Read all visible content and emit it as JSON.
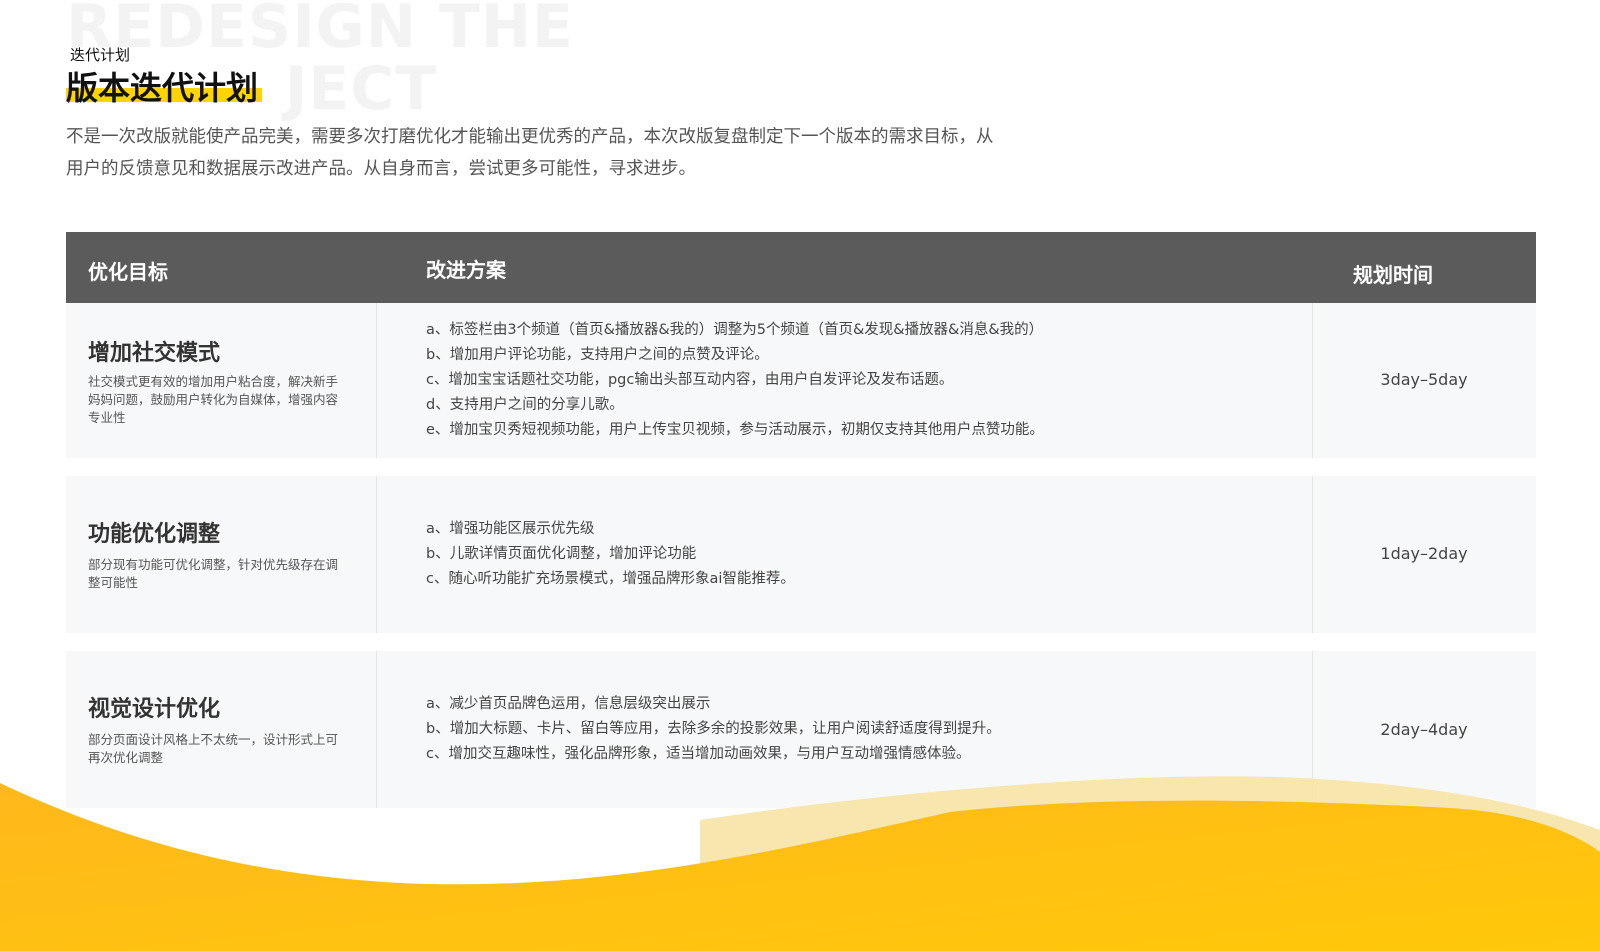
{
  "header": {
    "watermark": "REDESIGN THE\n          JECT",
    "eyebrow": "迭代计划",
    "title": "版本迭代计划",
    "intro": "不是一次改版就能使产品完美，需要多次打磨优化才能输出更优秀的产品，本次改版复盘制定下一个版本的需求目标，从用户的反馈意见和数据展示改进产品。从自身而言，尝试更多可能性，寻求进步。"
  },
  "table": {
    "headers": {
      "goal": "优化目标",
      "plan": "改进方案",
      "time": "规划时间"
    },
    "rows": [
      {
        "goal_title": "增加社交模式",
        "goal_desc": "社交模式更有效的增加用户粘合度，解决新手妈妈问题，鼓励用户转化为自媒体，增强内容专业性",
        "plans": [
          "a、标签栏由3个频道（首页&播放器&我的）调整为5个频道（首页&发现&播放器&消息&我的）",
          "b、增加用户评论功能，支持用户之间的点赞及评论。",
          "c、增加宝宝话题社交功能，pgc输出头部互动内容，由用户自发评论及发布话题。",
          "d、支持用户之间的分享儿歌。",
          "e、增加宝贝秀短视频功能，用户上传宝贝视频，参与活动展示，初期仅支持其他用户点赞功能。"
        ],
        "time": "3day–5day"
      },
      {
        "goal_title": "功能优化调整",
        "goal_desc": "部分现有功能可优化调整，针对优先级存在调整可能性",
        "plans": [
          "a、增强功能区展示优先级",
          "b、儿歌详情页面优化调整，增加评论功能",
          "c、随心听功能扩充场景模式，增强品牌形象ai智能推荐。"
        ],
        "time": "1day–2day"
      },
      {
        "goal_title": "视觉设计优化",
        "goal_desc": "部分页面设计风格上不太统一，设计形式上可再次优化调整",
        "plans": [
          "a、减少首页品牌色运用，信息层级突出展示",
          "b、增加大标题、卡片、留白等应用，去除多余的投影效果，让用户阅读舒适度得到提升。",
          "c、增加交互趣味性，强化品牌形象，适当增加动画效果，与用户互动增强情感体验。"
        ],
        "time": "2day–4day"
      }
    ]
  },
  "colors": {
    "accent": "#ffd400",
    "header_bg": "#5b5b5b",
    "row_bg": "#f7f8fa",
    "wave_yellow": "#ffbf1a",
    "wave_light": "#f7e3a6"
  }
}
